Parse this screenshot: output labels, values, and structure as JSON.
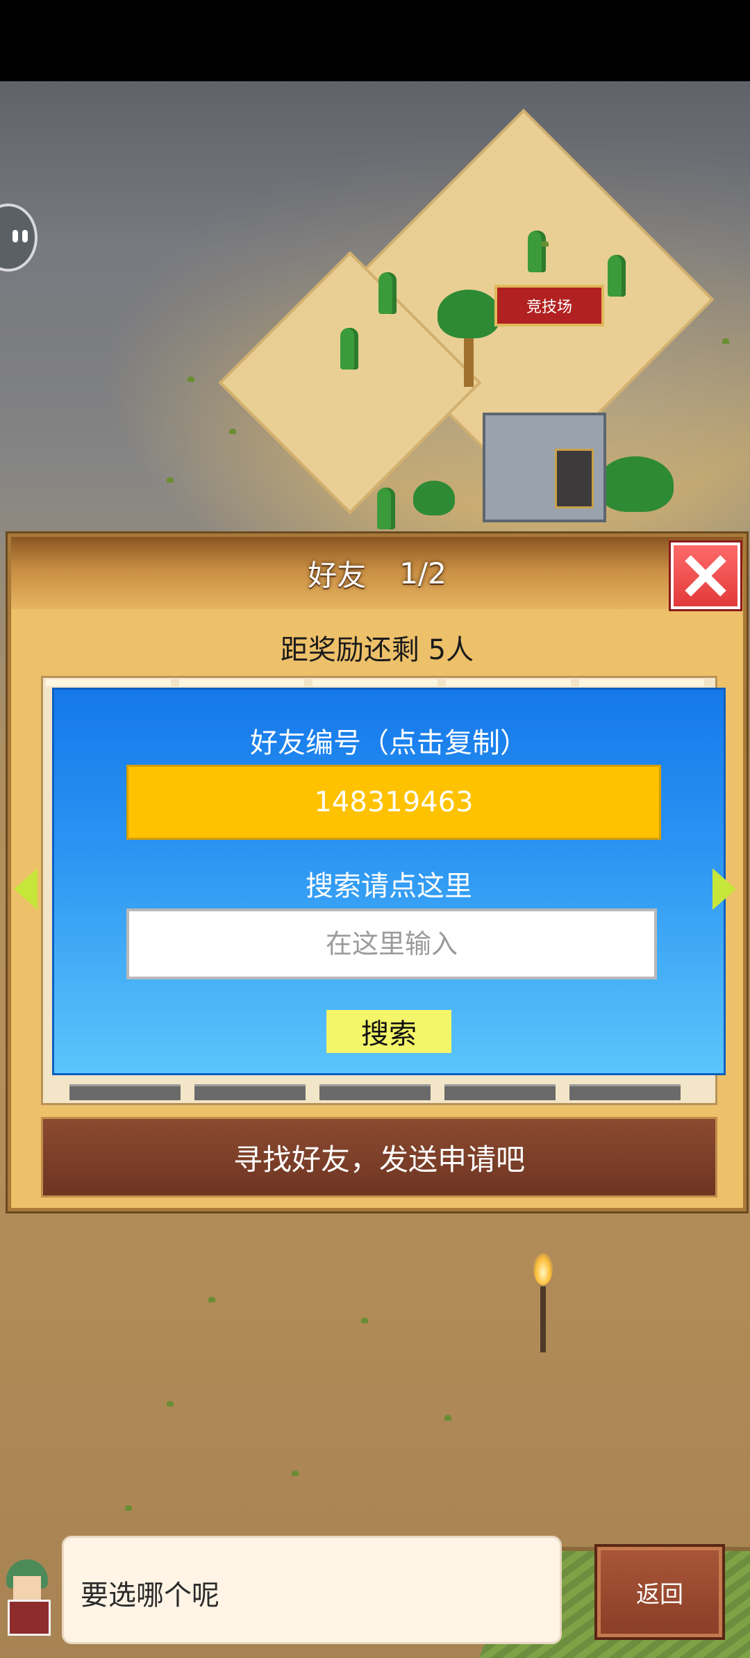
{
  "map": {
    "arena_label": "竞技场"
  },
  "dialog": {
    "title": "好友",
    "page": "1/2",
    "reward_text": "距奖励还剩 5人",
    "friend_id_label": "好友编号（点击复制）",
    "friend_id_value": "148319463",
    "search_label": "搜索请点这里",
    "search_placeholder": "在这里输入",
    "search_button": "搜索",
    "send_bar": "寻找好友，发送申请吧"
  },
  "bottom": {
    "speech": "要选哪个呢",
    "back_button": "返回"
  },
  "colors": {
    "dialog_bg": "#edc06a",
    "panel_blue": "#1478ea",
    "id_box": "#ffc200",
    "search_button": "#f4f66a",
    "close_red": "#e23a3a",
    "arrow_green": "#c7e63a"
  },
  "icons": [
    "close-icon",
    "arrow-left-icon",
    "arrow-right-icon",
    "chat-bubble-icon"
  ]
}
